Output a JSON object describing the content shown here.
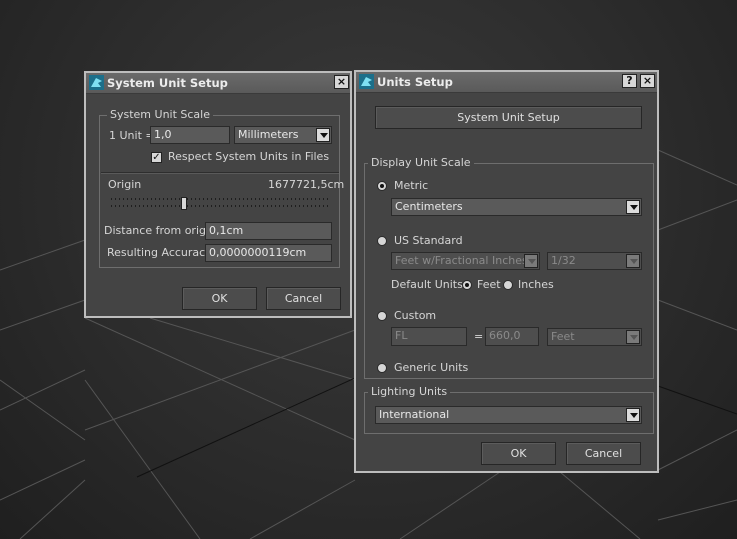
{
  "colors": {
    "dialog_bg": "#444444",
    "titlebar": "#5f5f5f",
    "field_bg": "#5a5a5a",
    "icon_accent": "#2aa6c8"
  },
  "system_dialog": {
    "title": "System Unit Setup",
    "close_glyph": "×",
    "group_label": "System Unit Scale",
    "unit_label": "1 Unit =",
    "unit_value": "1,0",
    "unit_select": "Millimeters",
    "respect_checkbox_checked": true,
    "respect_label": "Respect System Units in Files",
    "origin_label": "Origin",
    "origin_value": "1677721,5cm",
    "distance_label": "Distance from origin:",
    "distance_value": "0,1cm",
    "accuracy_label": "Resulting Accuracy:",
    "accuracy_value": "0,0000000119cm",
    "ok": "OK",
    "cancel": "Cancel"
  },
  "units_dialog": {
    "title": "Units Setup",
    "help_glyph": "?",
    "close_glyph": "×",
    "system_unit_setup_button": "System Unit Setup",
    "display_group": "Display Unit Scale",
    "metric_label": "Metric",
    "metric_selected": true,
    "metric_select": "Centimeters",
    "us_label": "US Standard",
    "us_select": "Feet w/Fractional Inches",
    "fraction_select": "1/32",
    "default_units_label": "Default Units:",
    "feet_label": "Feet",
    "inches_label": "Inches",
    "custom_label": "Custom",
    "custom_name": "FL",
    "equals": "=",
    "custom_value": "660,0",
    "custom_unit": "Feet",
    "generic_label": "Generic Units",
    "lighting_group": "Lighting Units",
    "lighting_select": "International",
    "ok": "OK",
    "cancel": "Cancel"
  }
}
